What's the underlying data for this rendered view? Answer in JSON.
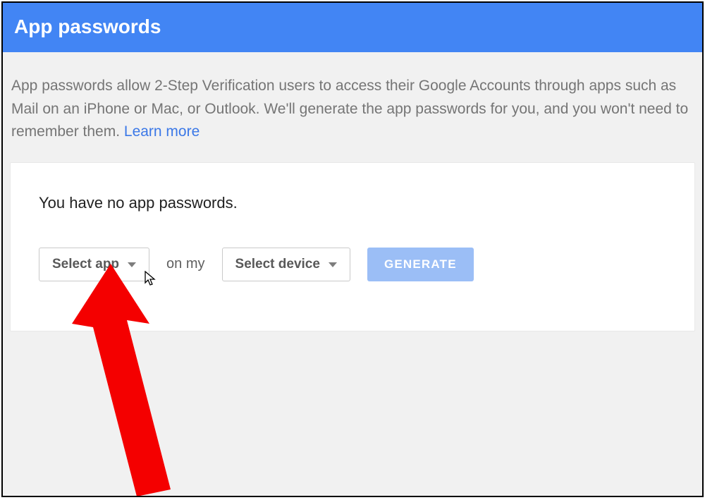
{
  "header": {
    "title": "App passwords"
  },
  "intro": {
    "text": "App passwords allow 2-Step Verification users to access their Google Accounts through apps such as Mail on an iPhone or Mac, or Outlook. We'll generate the app passwords for you, and you won't need to remember them. ",
    "learn_more": "Learn more"
  },
  "card": {
    "empty_msg": "You have no app passwords.",
    "select_app_label": "Select app",
    "on_my_label": "on my",
    "select_device_label": "Select device",
    "generate_label": "GENERATE"
  }
}
